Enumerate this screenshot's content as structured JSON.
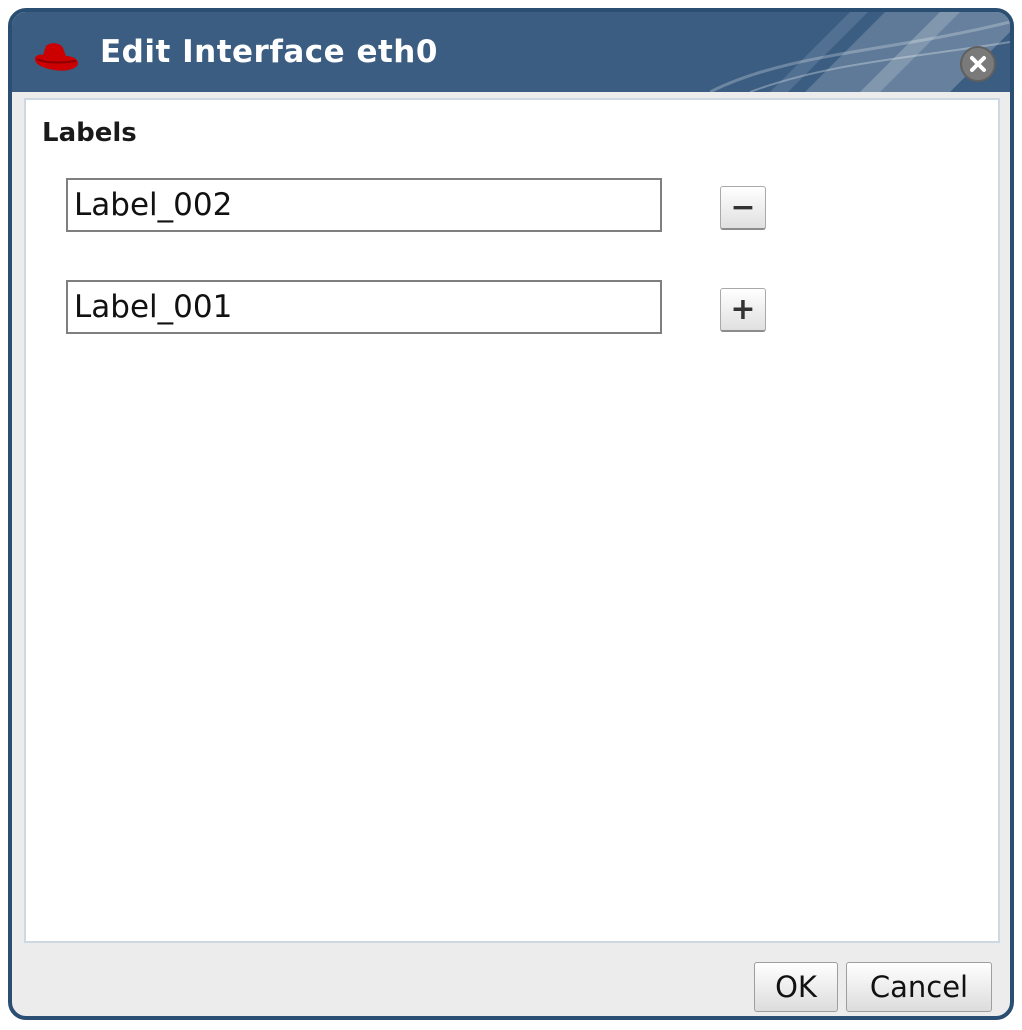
{
  "dialog": {
    "title": "Edit Interface eth0",
    "brand_icon": "red-hat-icon",
    "close_icon": "close-icon"
  },
  "labels": {
    "heading": "Labels",
    "rows": [
      {
        "value": "Label_002",
        "action": "−",
        "action_icon": "minus-icon"
      },
      {
        "value": "Label_001",
        "action": "+",
        "action_icon": "plus-icon"
      }
    ]
  },
  "footer": {
    "ok": "OK",
    "cancel": "Cancel"
  },
  "colors": {
    "titlebar": "#3b5d82",
    "border": "#2b4f73",
    "brand": "#cc0000"
  }
}
